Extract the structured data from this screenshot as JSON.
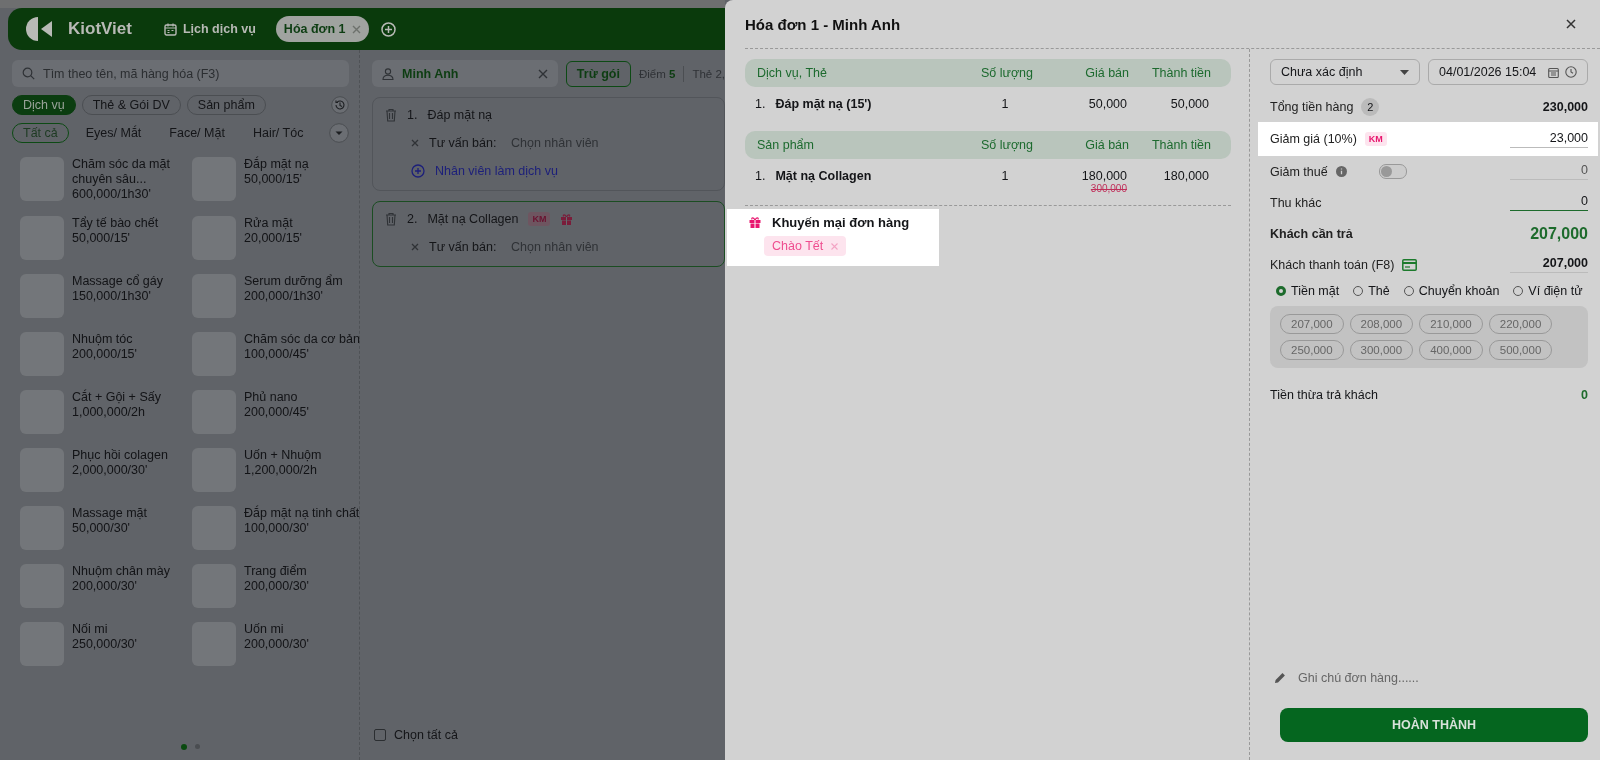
{
  "header": {
    "logo": "KiotViet",
    "tabs": [
      {
        "label": "Lịch dịch vụ",
        "kind": "calendar",
        "selected": false
      },
      {
        "label": "Hóa đơn 1",
        "kind": "invoice",
        "selected": true
      }
    ]
  },
  "catalog": {
    "search": {
      "placeholder": "Tìm theo tên, mã hàng hóa (F3)"
    },
    "groups": [
      {
        "label": "Dịch vụ",
        "selected": true
      },
      {
        "label": "Thẻ & Gói DV",
        "selected": false
      },
      {
        "label": "Sản phẩm",
        "selected": false
      }
    ],
    "categories": [
      {
        "label": "Tất cả",
        "selected": true
      },
      {
        "label": "Eyes/ Mắt",
        "selected": false
      },
      {
        "label": "Face/ Mặt",
        "selected": false
      },
      {
        "label": "Hair/ Tóc",
        "selected": false
      }
    ],
    "items": [
      {
        "name": "Chăm sóc da mặt chuyên sâu...",
        "price": "600,000/1h30'"
      },
      {
        "name": "Đắp mặt nạ",
        "price": "50,000/15'"
      },
      {
        "name": "Tẩy tế bào chết",
        "price": "50,000/15'"
      },
      {
        "name": "Rửa mặt",
        "price": "20,000/15'"
      },
      {
        "name": "Massage cổ gáy",
        "price": "150,000/1h30'"
      },
      {
        "name": "Serum dưỡng ẩm",
        "price": "200,000/1h30'"
      },
      {
        "name": "Nhuộm tóc",
        "price": "200,000/15'"
      },
      {
        "name": "Chăm sóc da cơ bản",
        "price": "100,000/45'"
      },
      {
        "name": "Cắt + Gội + Sấy",
        "price": "1,000,000/2h"
      },
      {
        "name": "Phủ nano",
        "price": "200,000/45'"
      },
      {
        "name": "Phục hồi colagen",
        "price": "2,000,000/30'"
      },
      {
        "name": "Uốn + Nhuộm",
        "price": "1,200,000/2h"
      },
      {
        "name": "Massage mặt",
        "price": "50,000/30'"
      },
      {
        "name": "Đắp mặt nạ tinh chất",
        "price": "100,000/30'"
      },
      {
        "name": "Nhuộm chân mày",
        "price": "200,000/30'"
      },
      {
        "name": "Trang điểm",
        "price": "200,000/30'"
      },
      {
        "name": "Nối mi",
        "price": "250,000/30'"
      },
      {
        "name": "Uốn mi",
        "price": "200,000/30'"
      }
    ],
    "pages": [
      {
        "selected": true
      },
      {
        "selected": false
      }
    ]
  },
  "order": {
    "customer": "Minh Anh",
    "package_button": "Trừ gói",
    "points_label": "Điểm",
    "points": "5",
    "card_info": "Thẻ 2,",
    "lines": [
      {
        "index": "1.",
        "name": "Đáp mặt nạ",
        "selected": false,
        "consultant_label": "Tư vấn bán:",
        "consultant_placeholder": "Chọn nhân viên",
        "add_staff": "Nhân viên làm dịch vụ"
      },
      {
        "index": "2.",
        "name": "Mặt nạ Collagen",
        "selected": true,
        "badge": "KM",
        "gift": true,
        "consultant_label": "Tư vấn bán:",
        "consultant_placeholder": "Chọn nhân viên"
      }
    ],
    "select_all": {
      "label": "Chọn tất cả",
      "checked": false
    }
  },
  "invoice": {
    "title": "Hóa đơn 1 - Minh Anh",
    "sections": [
      {
        "columns": [
          "Dịch vụ, Thẻ",
          "Số lượng",
          "Giá bán",
          "Thành tiền"
        ],
        "rows": [
          {
            "index": "1.",
            "name": "Đáp mặt nạ (15')",
            "qty": "1",
            "price": "50,000",
            "total": "50,000"
          }
        ]
      },
      {
        "columns": [
          "Sản phẩm",
          "Số lượng",
          "Giá bán",
          "Thành tiền"
        ],
        "rows": [
          {
            "index": "1.",
            "name": "Mặt nạ Collagen",
            "qty": "1",
            "price": "180,000",
            "old_price": "300,000",
            "total": "180,000"
          }
        ]
      }
    ],
    "promotion": {
      "title": "Khuyến mại đơn hàng",
      "highlighted": true,
      "tags": [
        "Chào Tết"
      ]
    },
    "sale_channel": "Chưa xác định",
    "datetime": "04/01/2026 15:04",
    "summary": [
      {
        "kind": "count",
        "label": "Tổng tiền hàng",
        "count": "2",
        "value": "230,000"
      },
      {
        "kind": "discount",
        "label": "Giảm giá (10%)",
        "badge": "KM",
        "value": "23,000",
        "highlighted": true
      },
      {
        "kind": "toggle",
        "label": "Giảm thuế",
        "on": false,
        "value": "0"
      },
      {
        "kind": "input",
        "label": "Thu khác",
        "value": "0"
      },
      {
        "kind": "total",
        "label": "Khách cần trả",
        "value": "207,000"
      },
      {
        "kind": "payment",
        "label": "Khách thanh toán (F8)",
        "value": "207,000"
      }
    ],
    "methods": [
      {
        "label": "Tiền mặt",
        "selected": true
      },
      {
        "label": "Thẻ",
        "selected": false
      },
      {
        "label": "Chuyển khoản",
        "selected": false
      },
      {
        "label": "Ví điện tử",
        "selected": false
      }
    ],
    "quick_amounts": [
      "207,000",
      "208,000",
      "210,000",
      "220,000",
      "250,000",
      "300,000",
      "400,000",
      "500,000"
    ],
    "change": {
      "label": "Tiền thừa trả khách",
      "value": "0"
    },
    "note": {
      "placeholder": "Ghi chú đơn hàng......"
    },
    "submit": "HOÀN THÀNH"
  }
}
